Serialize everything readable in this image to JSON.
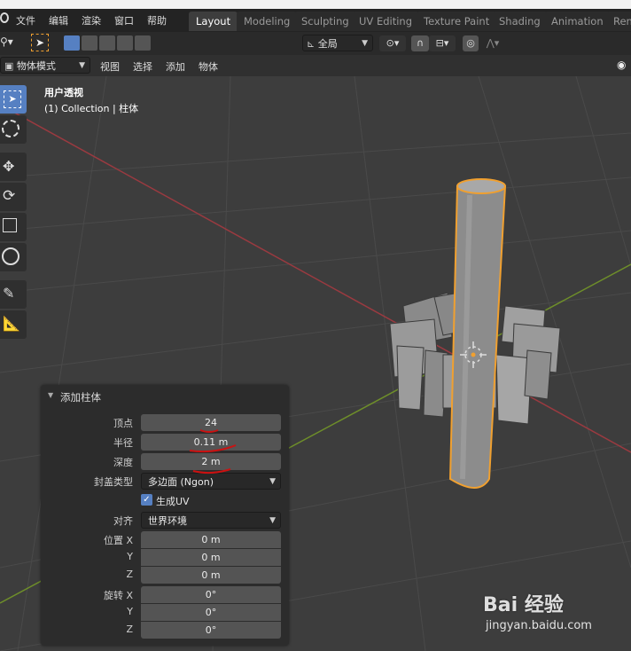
{
  "top_menu": {
    "file": "文件",
    "edit": "编辑",
    "render": "渲染",
    "window": "窗口",
    "help": "帮助"
  },
  "workspace_tabs": [
    "Layout",
    "Modeling",
    "Sculpting",
    "UV Editing",
    "Texture Paint",
    "Shading",
    "Animation",
    "Ren"
  ],
  "header": {
    "transform_orientation": "全局"
  },
  "viewport_header": {
    "mode": "物体模式",
    "view": "视图",
    "select": "选择",
    "add": "添加",
    "object": "物体"
  },
  "viewport": {
    "view_name": "用户透视",
    "collection_info": "(1) Collection | 柱体"
  },
  "operator_panel": {
    "title": "添加柱体",
    "vertices_label": "顶点",
    "vertices_value": "24",
    "radius_label": "半径",
    "radius_value": "0.11 m",
    "depth_label": "深度",
    "depth_value": "2 m",
    "cap_type_label": "封盖类型",
    "cap_type_value": "多边面 (Ngon)",
    "generate_uv_label": "生成UV",
    "generate_uv_checked": true,
    "align_label": "对齐",
    "align_value": "世界环境",
    "location_label": "位置 X",
    "location_x": "0 m",
    "y_label": "Y",
    "location_y": "0 m",
    "z_label": "Z",
    "location_z": "0 m",
    "rotation_label": "旋转 X",
    "rotation_x": "0°",
    "rotation_y": "0°",
    "rotation_z": "0°"
  },
  "watermark": {
    "brand": "Bai 经验",
    "url": "jingyan.baidu.com"
  },
  "colors": {
    "accent_blue": "#5680c2",
    "selection_orange": "#f0a030",
    "annotation_red": "#cc1111",
    "x_axis": "#9a3a40",
    "y_axis": "#6e8e2a"
  }
}
